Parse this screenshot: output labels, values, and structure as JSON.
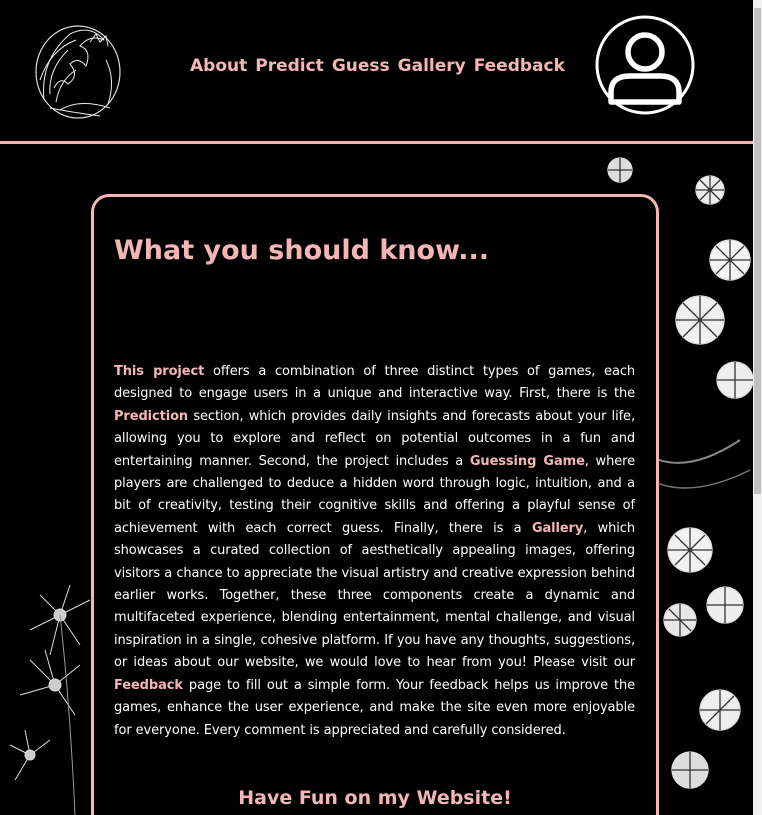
{
  "nav": {
    "items": [
      "About",
      "Predict",
      "Guess",
      "Gallery",
      "Feedback"
    ]
  },
  "main": {
    "title": "What you should know...",
    "body": {
      "this_project": "This project",
      "part1": " offers a combination of three distinct types of games, each designed to engage users in a unique and interactive way. First, there is the ",
      "prediction": "Prediction",
      "part2": " section, which provides daily insights and forecasts about your life, allowing you to explore and reflect on potential outcomes in a fun and entertaining manner. Second, the project includes a ",
      "guessing_game": "Guessing Game",
      "part3": ", where players are challenged to deduce a hidden word through logic, intuition, and a bit of creativity, testing their cognitive skills and offering a playful sense of achievement with each correct guess. Finally, there is a ",
      "gallery": "Gallery",
      "part4": ", which showcases a curated collection of aesthetically appealing images, offering visitors a chance to appreciate the visual artistry and creative expression behind earlier works. Together, these three components create a dynamic and multifaceted experience, blending entertainment, mental challenge, and visual inspiration in a single, cohesive platform. If you have any thoughts, suggestions, or ideas about our website, we would love to hear from you! Please visit our ",
      "feedback": "Feedback",
      "part5": " page to fill out a simple form. Your feedback helps us improve the games, enhance the user experience, and make the site even more enjoyable for everyone. Every comment is appreciated and carefully considered."
    },
    "footer": "Have Fun on my Website!"
  },
  "colors": {
    "accent": "#f4b6b4",
    "background": "#000000",
    "text": "#ffffff"
  },
  "icons": {
    "logo": "great-wave-logo-icon",
    "profile": "user-avatar-icon"
  }
}
